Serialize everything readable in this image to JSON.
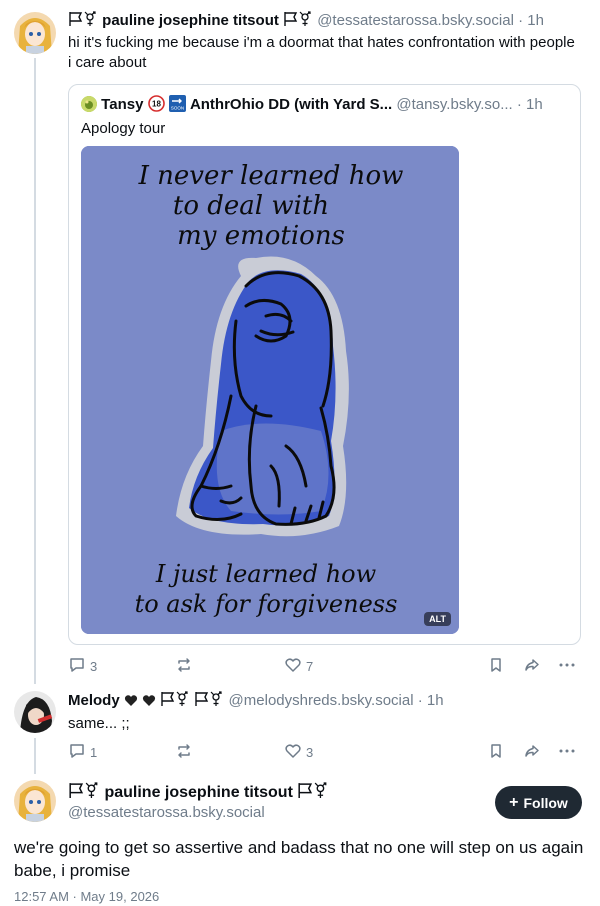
{
  "post1": {
    "author_name": "pauline josephine titsout",
    "handle": "@tessatestarossa.bsky.social",
    "time": "· 1h",
    "text": "hi it's fucking me because i'm a doormat that hates confrontation with people i care about",
    "avatar_icon": "anime-girl-avatar-icon",
    "quote": {
      "author_name": "Tansy",
      "author_name_extra": "AnthrOhio DD (with Yard S...",
      "handle": "@tansy.bsky.so...",
      "time": "· 1h",
      "text": "Apology tour",
      "image_alt_badge": "ALT",
      "image_text_top": [
        "I never learned how",
        "to deal with",
        "my emotions"
      ],
      "image_text_bottom": [
        "I just learned how",
        "to ask for forgiveness"
      ],
      "image_bg_color": "#7b8ac8"
    },
    "actions": {
      "replies": "3",
      "reposts": "",
      "likes": "7"
    }
  },
  "post2": {
    "author_name": "Melody",
    "handle": "@melodyshreds.bsky.social",
    "time": "· 1h",
    "text": "same... ;;",
    "actions": {
      "replies": "1",
      "reposts": "",
      "likes": "3"
    }
  },
  "post3": {
    "author_name": "pauline josephine titsout",
    "handle": "@tessatestarossa.bsky.social",
    "follow_label": "Follow",
    "text": "we're going to get so assertive and badass that no one will step on us again babe, i promise",
    "timestamp": "12:57 AM · May 19, 2026"
  },
  "colors": {
    "muted": "#6f7c8a",
    "border": "#d4dbe2",
    "follow_bg": "#1f2933"
  }
}
